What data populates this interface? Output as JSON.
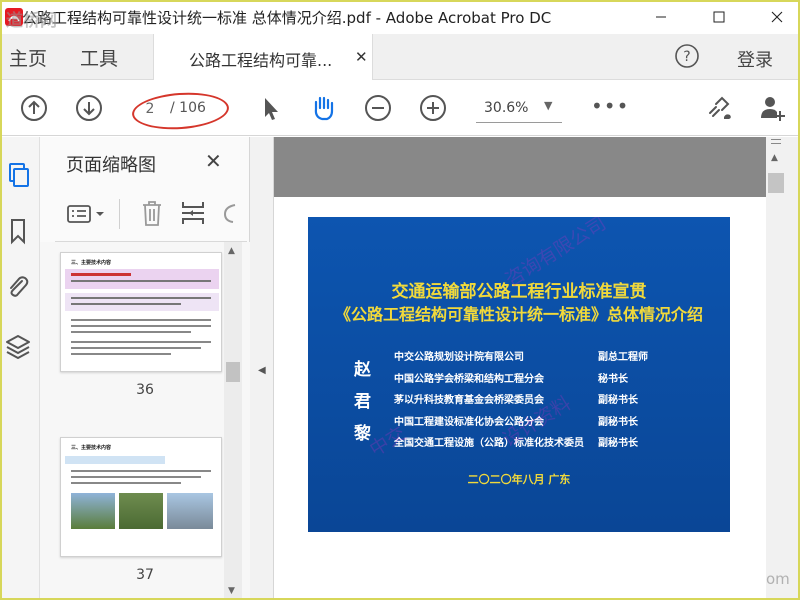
{
  "titlebar": {
    "title": "公路工程结构可靠性设计统一标准 总体情况介绍.pdf - Adobe Acrobat Pro DC",
    "app_icon": "acrobat-logo",
    "controls": [
      "minimize-icon",
      "maximize-icon",
      "close-icon"
    ]
  },
  "tabs": {
    "home": "主页",
    "tools": "工具",
    "document": "公路工程结构可靠...",
    "login": "登录"
  },
  "toolbar": {
    "page_current": "2",
    "page_total": "/ 106",
    "zoom": "30.6%",
    "more": "•••",
    "icons": [
      "prev-page-icon",
      "next-page-icon",
      "select-arrow-icon",
      "hand-tool-icon",
      "zoom-out-icon",
      "zoom-in-icon",
      "share-link-icon",
      "add-user-icon"
    ]
  },
  "thumbnail_panel": {
    "title": "页面缩略图",
    "close": "✕",
    "thumbnails": [
      {
        "page": "36",
        "heading": "三、主要技术内容"
      },
      {
        "page": "37",
        "heading": "三、主要技术内容"
      }
    ]
  },
  "slide": {
    "title_line1": "交通运输部公路工程行业标准宣贯",
    "title_line2": "《公路工程结构可靠性设计统一标准》总体情况介绍",
    "presenter_chars": [
      "赵",
      "君",
      "黎"
    ],
    "affiliations": [
      {
        "org": "中交公路规划设计院有限公司",
        "role": "副总工程师"
      },
      {
        "org": "中国公路学会桥梁和结构工程分会",
        "role": "秘书长"
      },
      {
        "org": "茅以升科技教育基金会桥梁委员会",
        "role": "副秘书长"
      },
      {
        "org": "中国工程建设标准化协会公路分会",
        "role": "副秘书长"
      },
      {
        "org": "全国交通工程设施（公路）标准化技术委员",
        "role": "副秘书长"
      }
    ],
    "date": "二〇二〇年八月  广东",
    "colors": {
      "background": "#0c4da3",
      "title": "#f1d93b",
      "text": "#ffffff"
    }
  },
  "colors": {
    "toolbar_icon": "#555555",
    "accent_blue": "#1473e6",
    "annotation_oval": "#d5362b",
    "viewport_bg": "#909090"
  }
}
